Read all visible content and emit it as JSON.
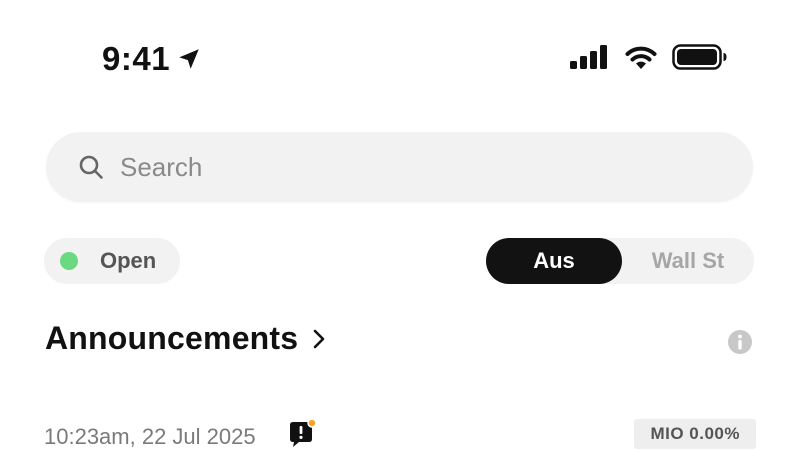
{
  "status_bar": {
    "time": "9:41",
    "icons": [
      "location-arrow-icon",
      "cellular-signal-icon",
      "wifi-icon",
      "battery-icon"
    ]
  },
  "search": {
    "placeholder": "Search",
    "value": ""
  },
  "market_status": {
    "label": "Open",
    "indicator_color": "#6ad97f"
  },
  "market_toggle": {
    "options": [
      "Aus",
      "Wall St"
    ],
    "selected": "Aus"
  },
  "announcements": {
    "title": "Announcements",
    "items": [
      {
        "timestamp": "10:23am, 22 Jul 2025",
        "ticker_change": "MIO 0.00%"
      }
    ]
  },
  "colors": {
    "accent": "#121212",
    "open_indicator": "#6ad97f",
    "badge_dot": "#f5a623"
  }
}
